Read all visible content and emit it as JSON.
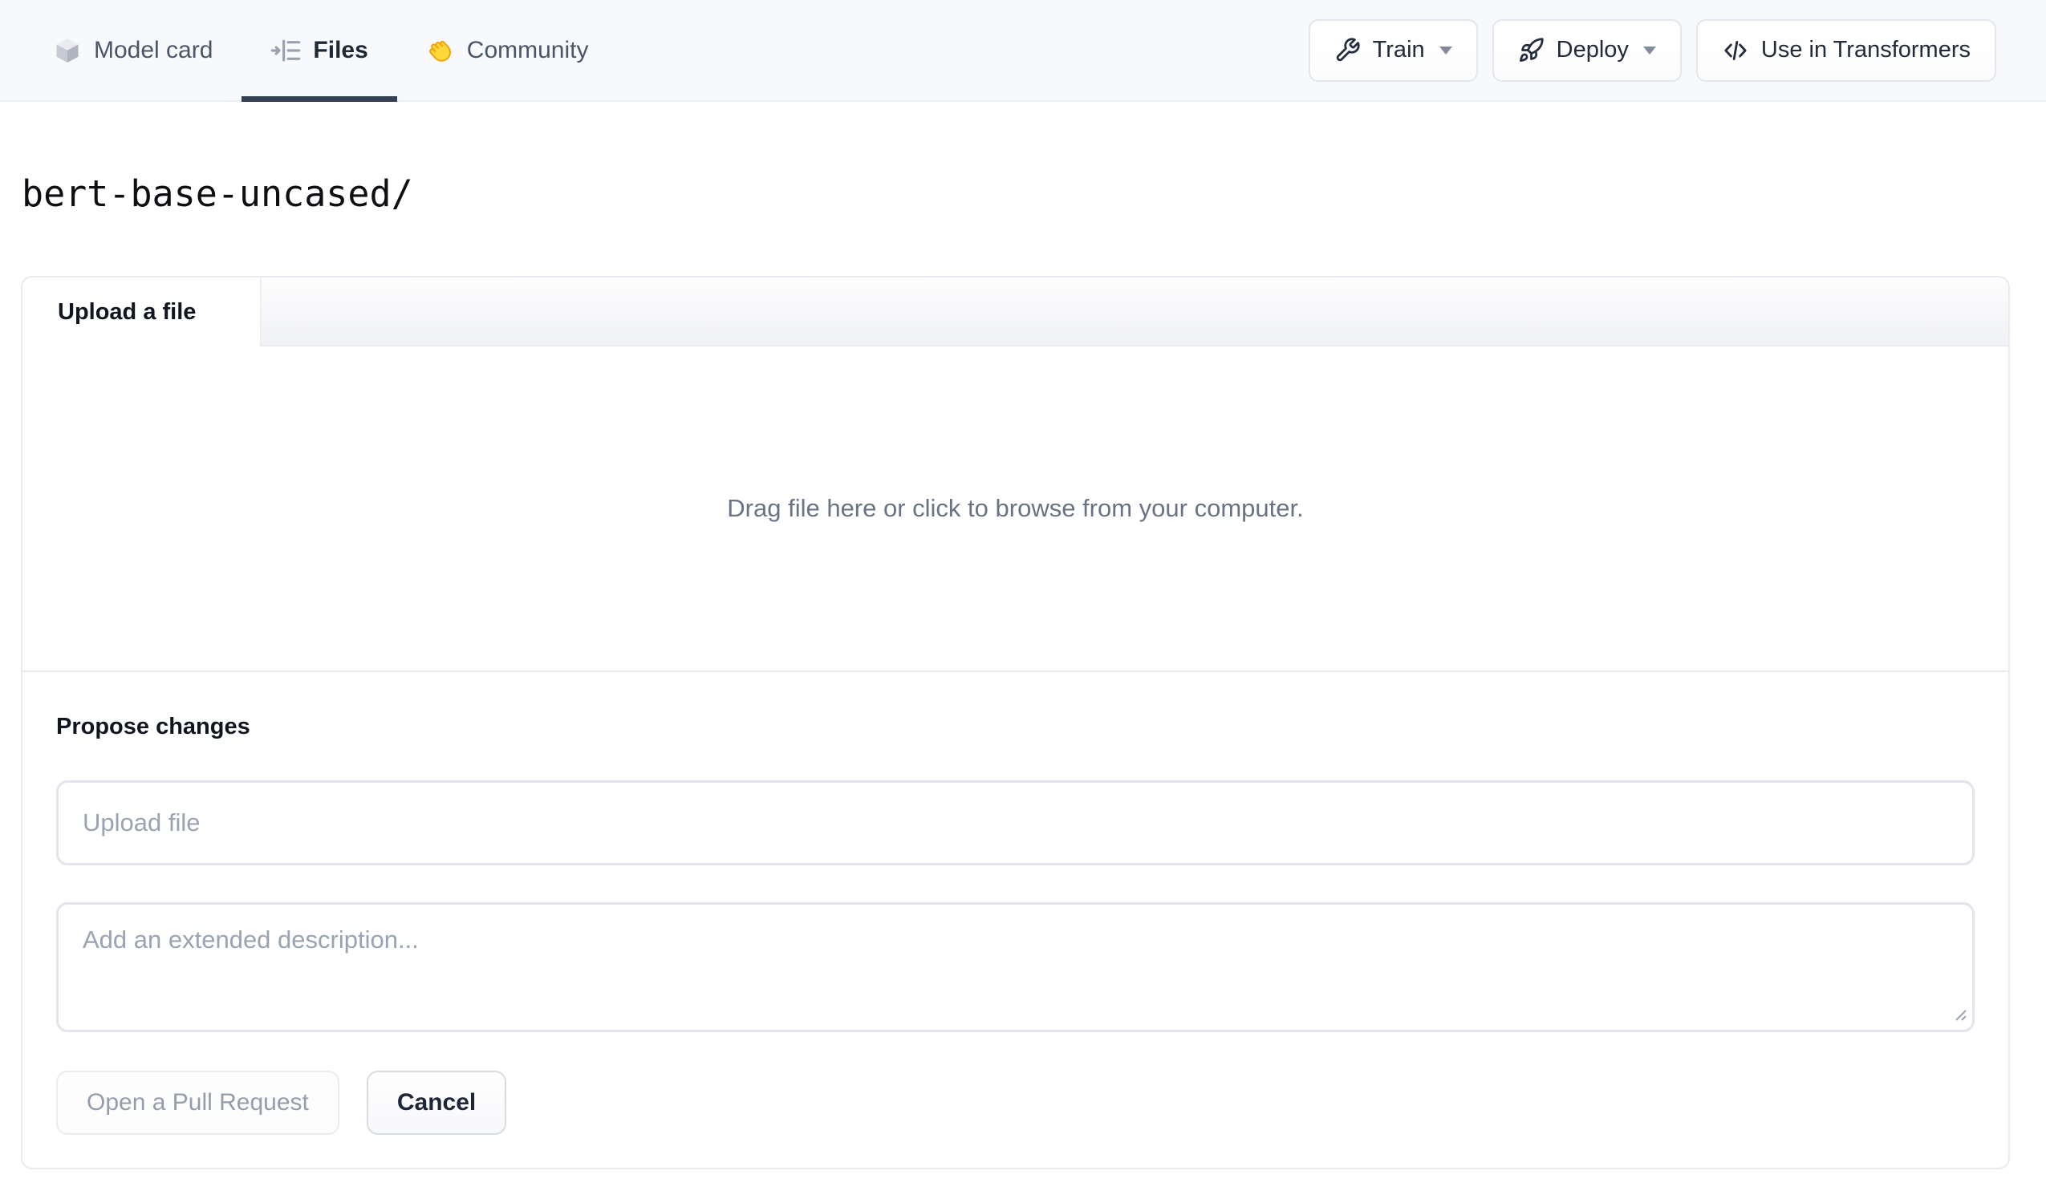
{
  "topbar": {
    "tabs": [
      {
        "label": "Model card",
        "icon": "cube-icon",
        "active": false
      },
      {
        "label": "Files",
        "icon": "files-list-icon",
        "active": true
      },
      {
        "label": "Community",
        "icon": "waving-hand-icon",
        "active": false
      }
    ],
    "actions": [
      {
        "label": "Train",
        "icon": "wrench-icon",
        "has_caret": true
      },
      {
        "label": "Deploy",
        "icon": "rocket-icon",
        "has_caret": true
      },
      {
        "label": "Use in Transformers",
        "icon": "code-icon",
        "has_caret": false
      }
    ]
  },
  "repo": {
    "path_title": "bert-base-uncased/"
  },
  "upload_card": {
    "tab_label": "Upload a file",
    "dropzone_text": "Drag file here or click to browse from your computer.",
    "propose_heading": "Propose changes",
    "file_input": {
      "value": "",
      "placeholder": "Upload file"
    },
    "description_input": {
      "value": "",
      "placeholder": "Add an extended description..."
    },
    "open_pr_label": "Open a Pull Request",
    "cancel_label": "Cancel"
  },
  "colors": {
    "topbar_bg": "#f8f9fc",
    "active_tab_underline": "#354052",
    "card_border": "#e8eaee",
    "muted_text": "#6a7384",
    "placeholder_text": "#9aa3b2",
    "hand_fill": "#FFD83B",
    "hand_stroke": "#F0A20C",
    "icon_dark": "#242d3e",
    "icon_gray": "#9aa1ad"
  }
}
